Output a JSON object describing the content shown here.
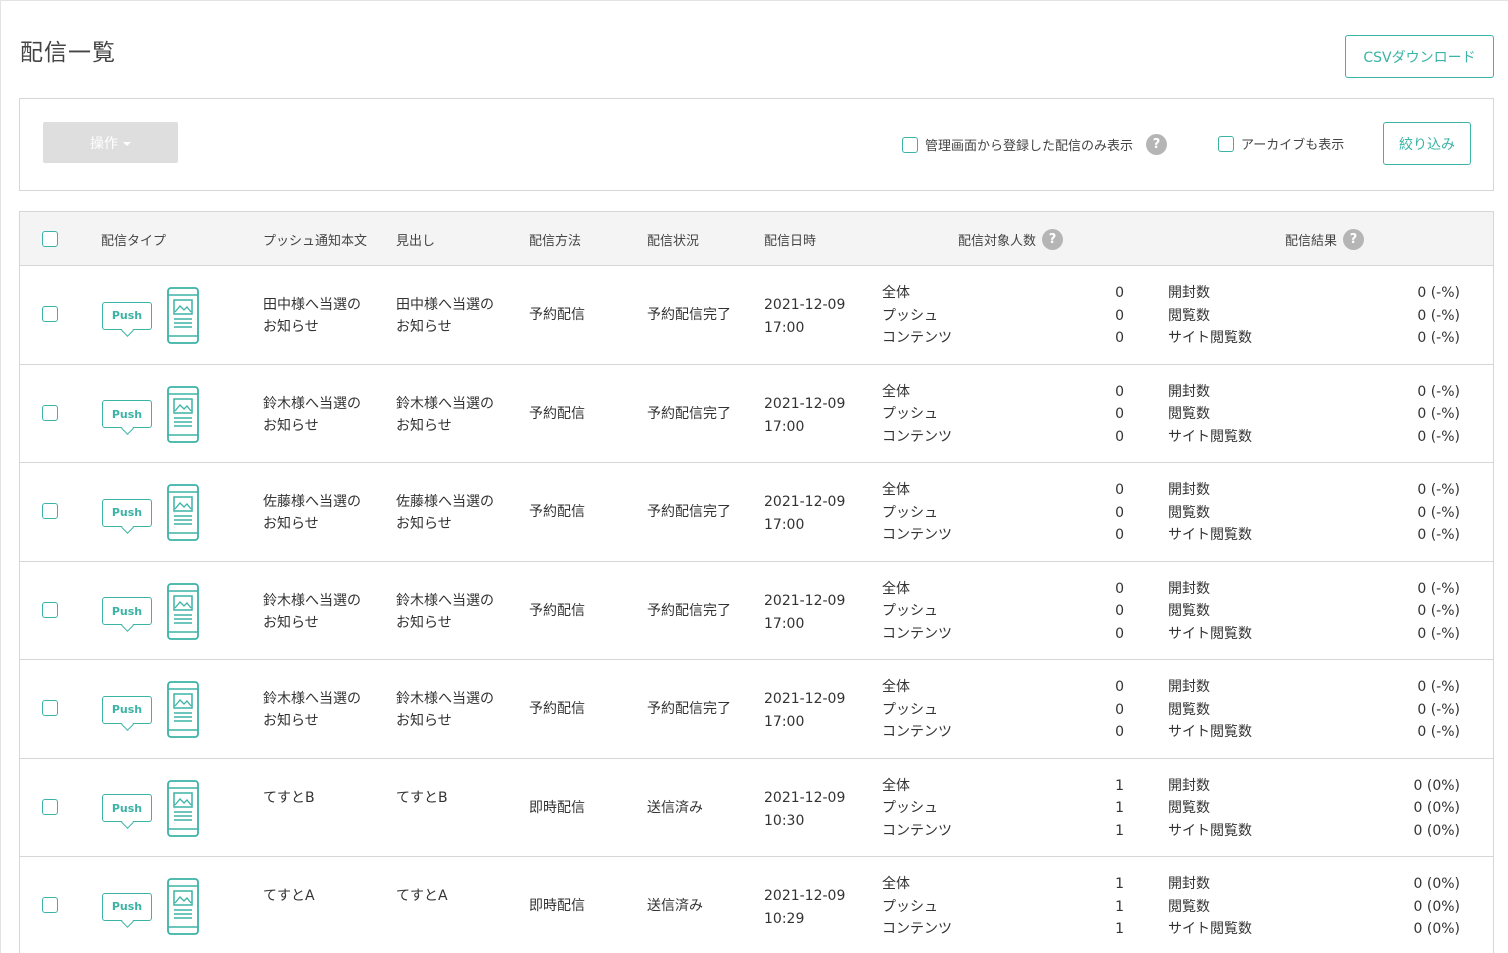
{
  "page": {
    "title": "配信一覧",
    "csv_button": "CSVダウンロード"
  },
  "filter": {
    "operation_button": "操作",
    "admin_only_label": "管理画面から登録した配信のみ表示",
    "archive_label": "アーカイブも表示",
    "narrow_button": "絞り込み",
    "help_glyph": "?"
  },
  "table": {
    "headers": {
      "type": "配信タイプ",
      "body": "プッシュ通知本文",
      "headline": "見出し",
      "method": "配信方法",
      "status": "配信状況",
      "datetime": "配信日時",
      "targets": "配信対象人数",
      "results": "配信結果"
    },
    "push_label": "Push",
    "target_labels": [
      "全体",
      "プッシュ",
      "コンテンツ"
    ],
    "result_labels": [
      "開封数",
      "閲覧数",
      "サイト閲覧数"
    ],
    "rows": [
      {
        "body": [
          "田中様へ当選の",
          "お知らせ"
        ],
        "headline": [
          "田中様へ当選の",
          "お知らせ"
        ],
        "method": "予約配信",
        "status": "予約配信完了",
        "date": "2021-12-09",
        "time": "17:00",
        "targets": [
          "0",
          "0",
          "0"
        ],
        "results": [
          "0 (-%)",
          "0 (-%)",
          "0 (-%)"
        ]
      },
      {
        "body": [
          "鈴木様へ当選の",
          "お知らせ"
        ],
        "headline": [
          "鈴木様へ当選の",
          "お知らせ"
        ],
        "method": "予約配信",
        "status": "予約配信完了",
        "date": "2021-12-09",
        "time": "17:00",
        "targets": [
          "0",
          "0",
          "0"
        ],
        "results": [
          "0 (-%)",
          "0 (-%)",
          "0 (-%)"
        ]
      },
      {
        "body": [
          "佐藤様へ当選の",
          "お知らせ"
        ],
        "headline": [
          "佐藤様へ当選の",
          "お知らせ"
        ],
        "method": "予約配信",
        "status": "予約配信完了",
        "date": "2021-12-09",
        "time": "17:00",
        "targets": [
          "0",
          "0",
          "0"
        ],
        "results": [
          "0 (-%)",
          "0 (-%)",
          "0 (-%)"
        ]
      },
      {
        "body": [
          "鈴木様へ当選の",
          "お知らせ"
        ],
        "headline": [
          "鈴木様へ当選の",
          "お知らせ"
        ],
        "method": "予約配信",
        "status": "予約配信完了",
        "date": "2021-12-09",
        "time": "17:00",
        "targets": [
          "0",
          "0",
          "0"
        ],
        "results": [
          "0 (-%)",
          "0 (-%)",
          "0 (-%)"
        ]
      },
      {
        "body": [
          "鈴木様へ当選の",
          "お知らせ"
        ],
        "headline": [
          "鈴木様へ当選の",
          "お知らせ"
        ],
        "method": "予約配信",
        "status": "予約配信完了",
        "date": "2021-12-09",
        "time": "17:00",
        "targets": [
          "0",
          "0",
          "0"
        ],
        "results": [
          "0 (-%)",
          "0 (-%)",
          "0 (-%)"
        ]
      },
      {
        "body": [
          "てすとB",
          ""
        ],
        "headline": [
          "てすとB",
          ""
        ],
        "method": "即時配信",
        "status": "送信済み",
        "date": "2021-12-09",
        "time": "10:30",
        "targets": [
          "1",
          "1",
          "1"
        ],
        "results": [
          "0 (0%)",
          "0 (0%)",
          "0 (0%)"
        ]
      },
      {
        "body": [
          "てすとA",
          ""
        ],
        "headline": [
          "てすとA",
          ""
        ],
        "method": "即時配信",
        "status": "送信済み",
        "date": "2021-12-09",
        "time": "10:29",
        "targets": [
          "1",
          "1",
          "1"
        ],
        "results": [
          "0 (0%)",
          "0 (0%)",
          "0 (0%)"
        ]
      }
    ]
  },
  "colors": {
    "accent": "#3bb3a6",
    "header_bg": "#f4f4f4",
    "border": "#d6d6d6",
    "help_bg": "#b5b5b5"
  }
}
